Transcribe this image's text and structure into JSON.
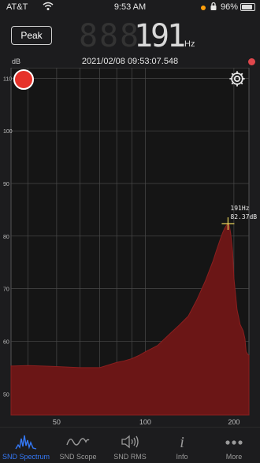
{
  "status_bar": {
    "carrier": "AT&T",
    "time": "9:53 AM",
    "battery": "96%"
  },
  "toolbar": {
    "peak_label": "Peak",
    "frequency_digits": [
      "1",
      "9",
      "1"
    ],
    "frequency_unit": "Hz"
  },
  "chart_header": {
    "y_unit": "dB",
    "timestamp": "2021/02/08 09:53:07.548"
  },
  "chart_data": {
    "type": "area",
    "x_axis": {
      "scale": "log",
      "range": [
        35,
        225
      ],
      "tick_labels": [
        50,
        100,
        200
      ]
    },
    "y_axis": {
      "range": [
        46,
        112
      ],
      "tick_labels": [
        50,
        60,
        70,
        80,
        90,
        100,
        110
      ]
    },
    "grid": true,
    "fill_color": "#6b1616",
    "stroke_color": "#8a1f1f",
    "marker_color": "#e8d35a",
    "peak_annotation": {
      "frequency": 191,
      "level": 82.37,
      "label_line1": "191Hz",
      "label_line2": "82.37dB"
    },
    "series": [
      {
        "x": [
          35,
          40,
          45,
          50,
          55,
          60,
          65,
          70,
          75,
          80,
          85,
          90,
          95,
          100,
          110,
          120,
          130,
          140,
          150,
          160,
          170,
          175,
          180,
          183,
          186,
          189,
          191,
          193,
          195,
          198,
          200,
          205,
          210,
          215,
          218,
          220,
          223,
          225
        ],
        "y": [
          55.3,
          55.4,
          55.3,
          55.2,
          55.1,
          55.0,
          55.0,
          55.0,
          55.5,
          56.0,
          56.3,
          56.7,
          57.3,
          58.0,
          59.2,
          61.2,
          63.0,
          64.8,
          68.0,
          71.5,
          75.3,
          77.5,
          79.5,
          80.6,
          81.5,
          82.1,
          82.37,
          82.0,
          80.5,
          77.0,
          72.0,
          66.0,
          63.2,
          62.0,
          60.5,
          58.0,
          57.5,
          57.3
        ]
      }
    ]
  },
  "tabs": [
    {
      "label": "SND Spectrum",
      "icon": "spectrum-icon",
      "active": true
    },
    {
      "label": "SND Scope",
      "icon": "waveform-icon",
      "active": false
    },
    {
      "label": "SND RMS",
      "icon": "speaker-icon",
      "active": false
    },
    {
      "label": "Info",
      "icon": "info-icon",
      "active": false
    },
    {
      "label": "More",
      "icon": "more-icon",
      "active": false
    }
  ],
  "colors": {
    "accent": "#3478f6",
    "record": "#e6322a",
    "status_light": "#e0474c"
  }
}
